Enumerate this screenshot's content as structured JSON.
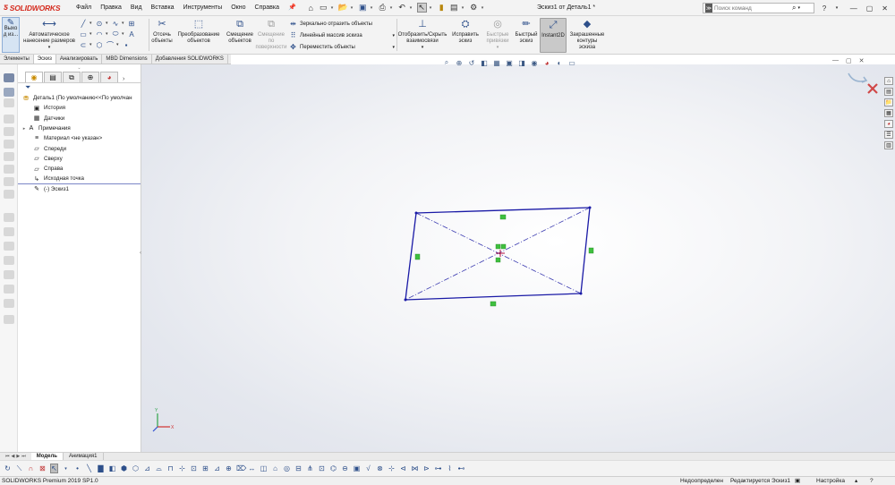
{
  "app": {
    "logo_text": "SOLIDWORKS",
    "doc_title": "Эскиз1 от Деталь1 *"
  },
  "menu": [
    "Файл",
    "Правка",
    "Вид",
    "Вставка",
    "Инструменты",
    "Окно",
    "Справка"
  ],
  "search": {
    "placeholder": "Поиск команд"
  },
  "ribbon": {
    "exit_sketch": "Выхо\nд из...",
    "smart_dim": "Автоматическое\nнанесение размеров",
    "trim": "Отсечь\nобъекты",
    "convert": "Преобразование\nобъектов",
    "offset": "Смещение\nобъектов",
    "offset_surface": "Смещение\nпо\nповерхности",
    "mirror": "Зеркально отразить объекты",
    "linear_pattern": "Линейный массив эскиза",
    "move": "Переместить объекты",
    "show_hide_relations": "Отобразить/Скрыть\nвзаимосвязи",
    "repair_sketch": "Исправить\nэскиз",
    "quick_snaps": "Быстрые\nпривязки",
    "rapid_sketch": "Быстрый\nэскиз",
    "instant2d": "Instant2D",
    "shaded_contours": "Закрашенные\nконтуры\nэскиза"
  },
  "tabs": [
    "Элементы",
    "Эскиз",
    "Анализировать",
    "MBD Dimensions",
    "Добавления SOLIDWORKS"
  ],
  "active_tab": "Эскиз",
  "feature_tree": {
    "root": "Деталь1  (По умолчанию<<По умолчан",
    "items": [
      {
        "label": "История",
        "icon": "history-icon"
      },
      {
        "label": "Датчики",
        "icon": "sensors-icon"
      },
      {
        "label": "Примечания",
        "icon": "annotations-icon"
      },
      {
        "label": "Материал <не указан>",
        "icon": "material-icon"
      },
      {
        "label": "Спереди",
        "icon": "plane-icon"
      },
      {
        "label": "Сверху",
        "icon": "plane-icon"
      },
      {
        "label": "Справа",
        "icon": "plane-icon"
      },
      {
        "label": "Исходная точка",
        "icon": "origin-icon"
      },
      {
        "label": "(-) Эскиз1",
        "icon": "sketch-icon"
      }
    ]
  },
  "bottom_tabs": [
    "Модель",
    "Анимация1"
  ],
  "status": {
    "version": "SOLIDWORKS Premium 2019 SP1.0",
    "defined": "Недоопределен",
    "editing": "Редактируется Эскиз1",
    "settings": "Настройка"
  },
  "colors": {
    "sketch_line": "#1a1aa6",
    "relation_marker": "#3fbf3f",
    "brand_red": "#d52b1e"
  }
}
